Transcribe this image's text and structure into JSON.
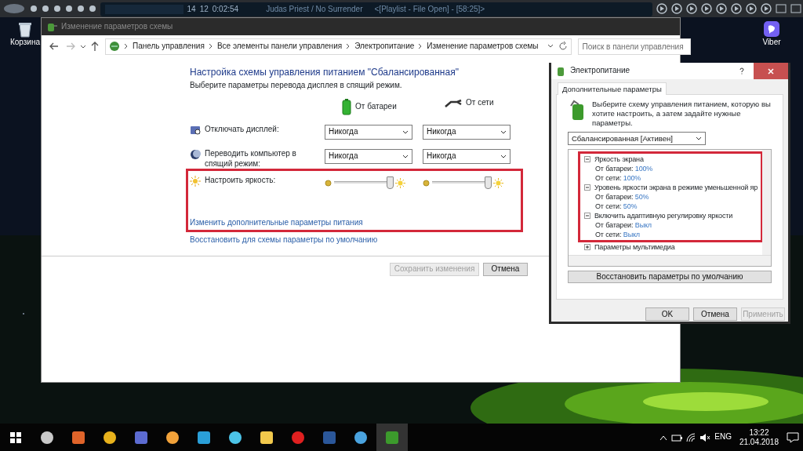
{
  "media_player": {
    "track": "14",
    "index": "12",
    "time": "0:02:54",
    "title": "Judas Priest / No Surrender",
    "playlist": "<[Playlist - File Open] - [58:25]>"
  },
  "desktop_icons": [
    {
      "label": "Корзина"
    },
    {
      "label": "Viber"
    }
  ],
  "window": {
    "title": "Изменение параметров схемы",
    "breadcrumb": [
      "Панель управления",
      "Все элементы панели управления",
      "Электропитание",
      "Изменение параметров схемы"
    ],
    "search": {
      "placeholder": "Поиск в панели управления"
    },
    "heading": "Настройка схемы управления питанием \"Сбалансированная\"",
    "subheading": "Выберите параметры перевода дисплея в спящий режим.",
    "columns": [
      "От батареи",
      "От сети"
    ],
    "settings": [
      {
        "kind": "dropdown",
        "label": "Отключать дисплей:",
        "values": [
          "Никогда",
          "Никогда"
        ]
      },
      {
        "kind": "dropdown",
        "label": "Переводить компьютер в спящий режим:",
        "values": [
          "Никогда",
          "Никогда"
        ]
      },
      {
        "kind": "slider",
        "label": "Настроить яркость:",
        "sliders": [
          {
            "level": 1
          },
          {
            "level": 1
          }
        ]
      }
    ],
    "links": [
      "Изменить дополнительные параметры питания",
      "Восстановить для схемы параметры по умолчанию"
    ],
    "buttons": [
      {
        "label": "Сохранить изменения",
        "disabled": true
      },
      {
        "label": "Отмена",
        "disabled": false
      }
    ]
  },
  "dialog": {
    "title": "Электропитание",
    "tabs": [
      {
        "label": "Дополнительные параметры",
        "selected": true
      }
    ],
    "description": "Выберите схему управления питанием, которую вы хотите настроить, а затем задайте нужные параметры.",
    "scheme": "Сбалансированная [Активен]",
    "tree": [
      {
        "label": "Яркость экрана",
        "expanded": true,
        "children": [
          {
            "label": "От батареи:",
            "value": "100%"
          },
          {
            "label": "От сети:",
            "value": "100%"
          }
        ]
      },
      {
        "label": "Уровень яркости экрана в режиме уменьшенной яр",
        "expanded": true,
        "children": [
          {
            "label": "От батареи:",
            "value": "50%"
          },
          {
            "label": "От сети:",
            "value": "50%"
          }
        ]
      },
      {
        "label": "Включить адаптивную регулировку яркости",
        "expanded": true,
        "children": [
          {
            "label": "От батареи:",
            "value": "Выкл"
          },
          {
            "label": "От сети:",
            "value": "Выкл"
          }
        ]
      },
      {
        "label": "Параметры мультимедиа",
        "expanded": false
      }
    ],
    "restore_button": "Восстановить параметры по умолчанию",
    "buttons": [
      {
        "label": "OK",
        "disabled": false
      },
      {
        "label": "Отмена",
        "disabled": false
      },
      {
        "label": "Применить",
        "disabled": true
      }
    ]
  },
  "taskbar": {
    "language": "ENG",
    "time": "13:22",
    "date": "21.04.2018"
  }
}
